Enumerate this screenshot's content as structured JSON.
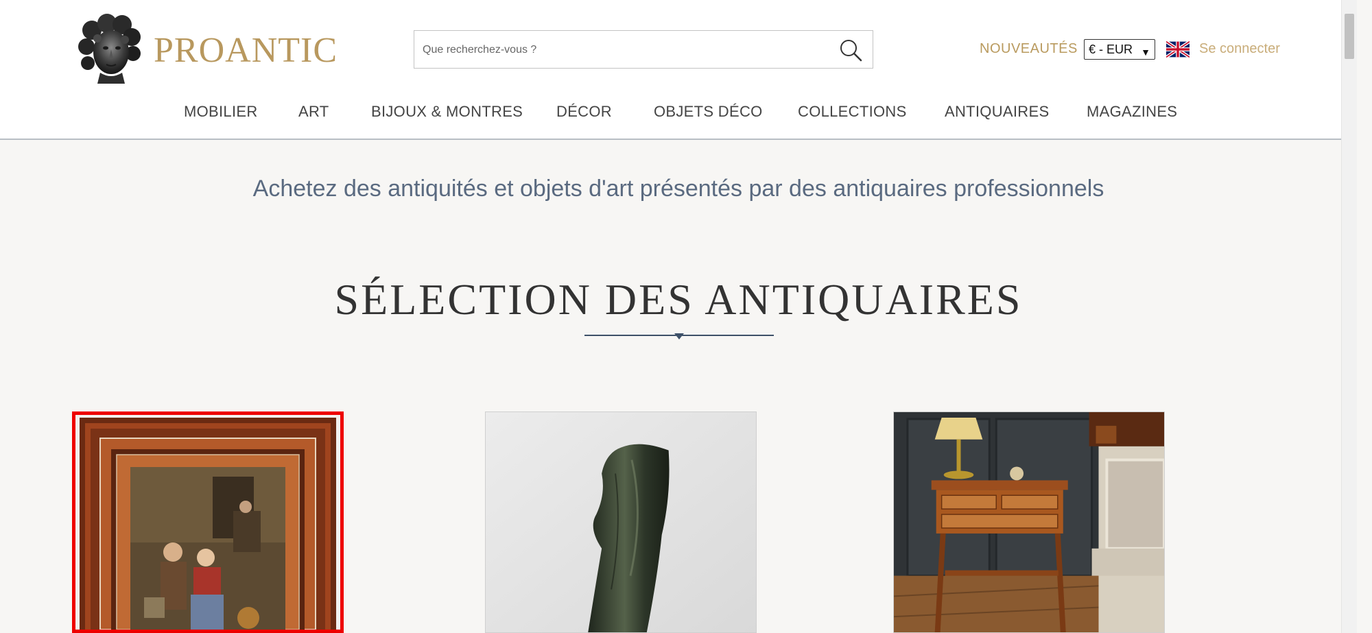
{
  "brand": {
    "name": "PROANTIC",
    "logo_icon": "bust-statue-icon",
    "color": "#b8985e"
  },
  "search": {
    "placeholder": "Que recherchez-vous ?",
    "value": "",
    "icon": "search-icon"
  },
  "topbar": {
    "new_label": "NOUVEAUTÉS",
    "currency": "€ - EUR",
    "language_icon": "uk-flag-icon",
    "login_label": "Se connecter"
  },
  "nav": {
    "items": [
      {
        "label": "MOBILIER"
      },
      {
        "label": "ART"
      },
      {
        "label": "BIJOUX & MONTRES"
      },
      {
        "label": "DÉCOR"
      },
      {
        "label": "OBJETS DÉCO"
      },
      {
        "label": "COLLECTIONS"
      },
      {
        "label": "ANTIQUAIRES"
      },
      {
        "label": "MAGAZINES"
      }
    ]
  },
  "main": {
    "tagline": "Achetez des antiquités et objets d'art présentés par des antiquaires professionnels",
    "section_title": "SÉLECTION DES ANTIQUAIRES",
    "cards": [
      {
        "image": "framed-tavern-painting",
        "highlighted": true
      },
      {
        "image": "draped-bronze-figure",
        "highlighted": false
      },
      {
        "image": "marquetry-side-table",
        "highlighted": false
      }
    ]
  },
  "colors": {
    "accent_gold": "#b99a5e",
    "tagline_blue": "#5a6a80",
    "highlight_red": "#ee0000"
  }
}
